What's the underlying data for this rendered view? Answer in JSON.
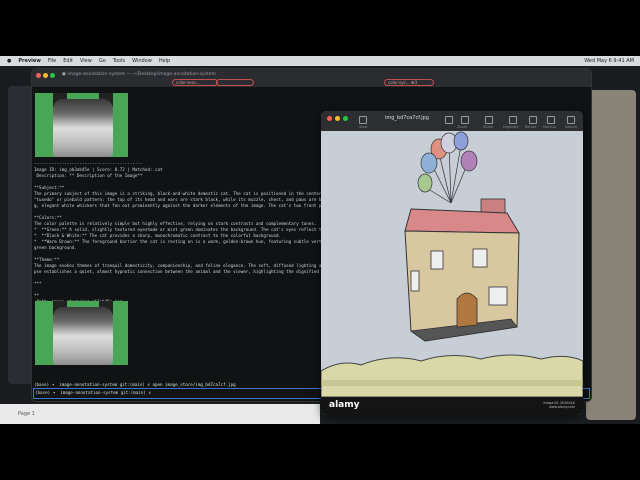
{
  "menubar": {
    "app": "Preview",
    "items": [
      "File",
      "Edit",
      "View",
      "Go",
      "Tools",
      "Window",
      "Help"
    ],
    "right": "Wed May 6  9:41 AM"
  },
  "terminal": {
    "title": "● image-annotation-system — ~/Desktop/image-annotation-system",
    "tabs": [
      "",
      "",
      "color-sess...",
      "",
      "",
      "",
      "",
      "color-sys... ⌘3",
      "",
      ""
    ],
    "block1": "-------------------------------------------\nImage ID: img_ab3ab45e | Score: 0.72 | Matched: cat\n Description: ** Description of the Image**\n\n**Subject:**\nThe primary subject of this image is a striking, black-and-white domestic cat. The cat is positioned in the center of the\n\"tuxedo\" or piebald pattern: the top of its head and ears are stark black, while its muzzle, chest, and paws are bright w\ng, elegant white whiskers that fan out prominently against the darker elements of the image. The cat's two front paws are\n\n**Colors:**\nThe color palette is relatively simple but highly effective, relying on stark contrasts and complementary tones.\n*  **Green:** A solid, slightly textured eyeshade or mint green dominates the background. The cat's eyes reflect this exac\n*  **Black & White:** The cat provides a sharp, monochromatic contrast to the colorful background.\n*  **Warm Brown:** The foreground barrier the cat is resting on is a warm, golden-brown hue, featuring subtle vertical li\ngreen background.\n\n**Theme:**\nThe image evokes themes of tranquil domesticity, companionship, and feline elegance. The soft, diffused lighting and shall\npse establishes a quiet, almost hypnotic connection between the animal and the viewer, highlighting the dignified and curi\n\n***\n\n**\n Path: image_store/img_ab3ab45e.jpg",
    "prompt1": "(base) ➜  image-annotation-system git:(main) ✗ open image_store/img_bd7ca7cf.jpg",
    "prompt2": "(base) ➜  image-annotation-system git:(main) ✗ "
  },
  "viewer": {
    "title": "img_bd7ca7cf.jpg",
    "toolbar": [
      "View",
      "",
      "",
      "Zoom",
      "Share",
      "Highlight",
      "Rotate",
      "Markup",
      "Search"
    ],
    "footer_brand": "alamy",
    "footer_id": "Image ID: 2EXXXXX\nwww.alamy.com"
  },
  "statusbar": {
    "page": "Page 1"
  },
  "colors": {
    "accent": "#3a78c8",
    "green_thumb": "#4aa657"
  }
}
